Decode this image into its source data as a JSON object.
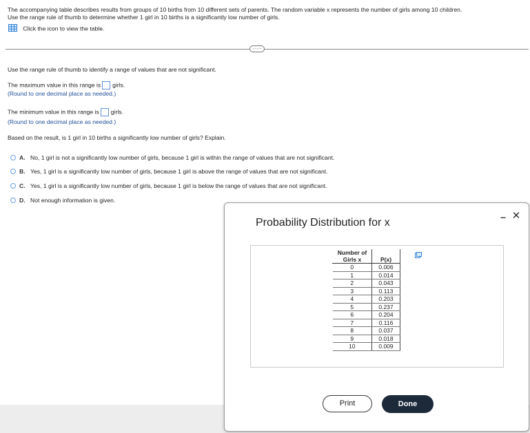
{
  "intro": {
    "line1": "The accompanying table describes results from groups of 10 births from 10 different sets of parents. The random variable x represents the number of girls among 10 children.",
    "line2": "Use the range rule of thumb to determine whether 1 girl in 10 births is a significantly low number of girls.",
    "table_link": "Click the icon to view the table."
  },
  "more_label": "·····",
  "question": {
    "instruction": "Use the range rule of thumb to identify a range of values that are not significant.",
    "max_prefix": "The maximum value in this range is",
    "max_suffix": "girls.",
    "max_hint": "(Round to one decimal place as needed.)",
    "max_value": "",
    "min_prefix": "The minimum value in this range is",
    "min_suffix": "girls.",
    "min_hint": "(Round to one decimal place as needed.)",
    "min_value": "",
    "based": "Based on the result, is 1 girl in 10 births a significantly low number of girls? Explain."
  },
  "choices": [
    {
      "letter": "A.",
      "text": "No, 1 girl is not a significantly low number of girls, because 1 girl is within the range of values that are not significant."
    },
    {
      "letter": "B.",
      "text": "Yes, 1 girl is a significantly low number of girls, because 1 girl is above the range of values that are not significant."
    },
    {
      "letter": "C.",
      "text": "Yes, 1 girl is a significantly low number of girls, because 1 girl is below the range of values that are not significant."
    },
    {
      "letter": "D.",
      "text": "Not enough information is given."
    }
  ],
  "dialog": {
    "title": "Probability Distribution for x",
    "minimize": "–",
    "close": "✕",
    "headers": [
      "Number of Girls x",
      "P(x)"
    ],
    "header1_line1": "Number of",
    "header1_line2": "Girls x",
    "rows": [
      [
        "0",
        "0.006"
      ],
      [
        "1",
        "0.014"
      ],
      [
        "2",
        "0.043"
      ],
      [
        "3",
        "0.113"
      ],
      [
        "4",
        "0.203"
      ],
      [
        "5",
        "0.237"
      ],
      [
        "6",
        "0.204"
      ],
      [
        "7",
        "0.116"
      ],
      [
        "8",
        "0.037"
      ],
      [
        "9",
        "0.018"
      ],
      [
        "10",
        "0.009"
      ]
    ],
    "print_label": "Print",
    "done_label": "Done"
  },
  "colors": {
    "accent": "#1f4e9a",
    "radio": "#6a9fdc",
    "done_bg": "#1d2a3a"
  }
}
